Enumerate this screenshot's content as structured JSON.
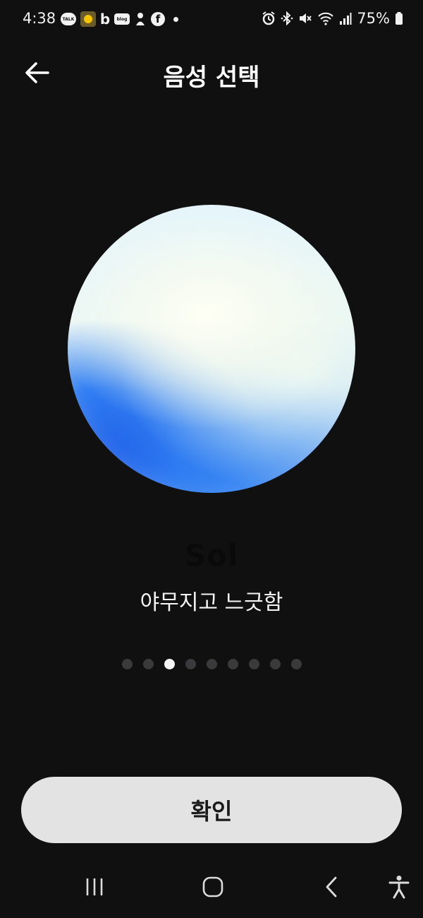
{
  "status_bar": {
    "time": "4:38",
    "notification_icons": [
      "talk-icon",
      "yellow-app-icon",
      "bing-icon",
      "blog-icon",
      "baby-icon",
      "facebook-icon",
      "dot-icon"
    ],
    "talk_badge": "TALK",
    "blog_badge": "blog",
    "bing_glyph": "b",
    "facebook_glyph": "f",
    "system_icons": [
      "alarm-icon",
      "bluetooth-icon",
      "mute-icon",
      "wifi-icon",
      "signal-icon",
      "battery-icon"
    ],
    "battery": "75%"
  },
  "header": {
    "title": "음성 선택",
    "back_icon": "arrow-left-icon"
  },
  "voice": {
    "name": "Sol",
    "description": "야무지고 느긋함",
    "orb_colors": {
      "light": "#e2f4fb",
      "cream": "#fffff4",
      "blue": "#2d6fe9"
    }
  },
  "pager": {
    "total": 9,
    "active_index": 2
  },
  "confirm_button": {
    "label": "확인"
  },
  "nav_bar": {
    "icons": [
      "recents-icon",
      "home-icon",
      "back-icon",
      "accessibility-icon"
    ]
  },
  "colors": {
    "background": "#101011",
    "button_bg": "#e3e3e3",
    "dot_active": "#f5f5f5",
    "dot_inactive": "#3a3a3c"
  }
}
